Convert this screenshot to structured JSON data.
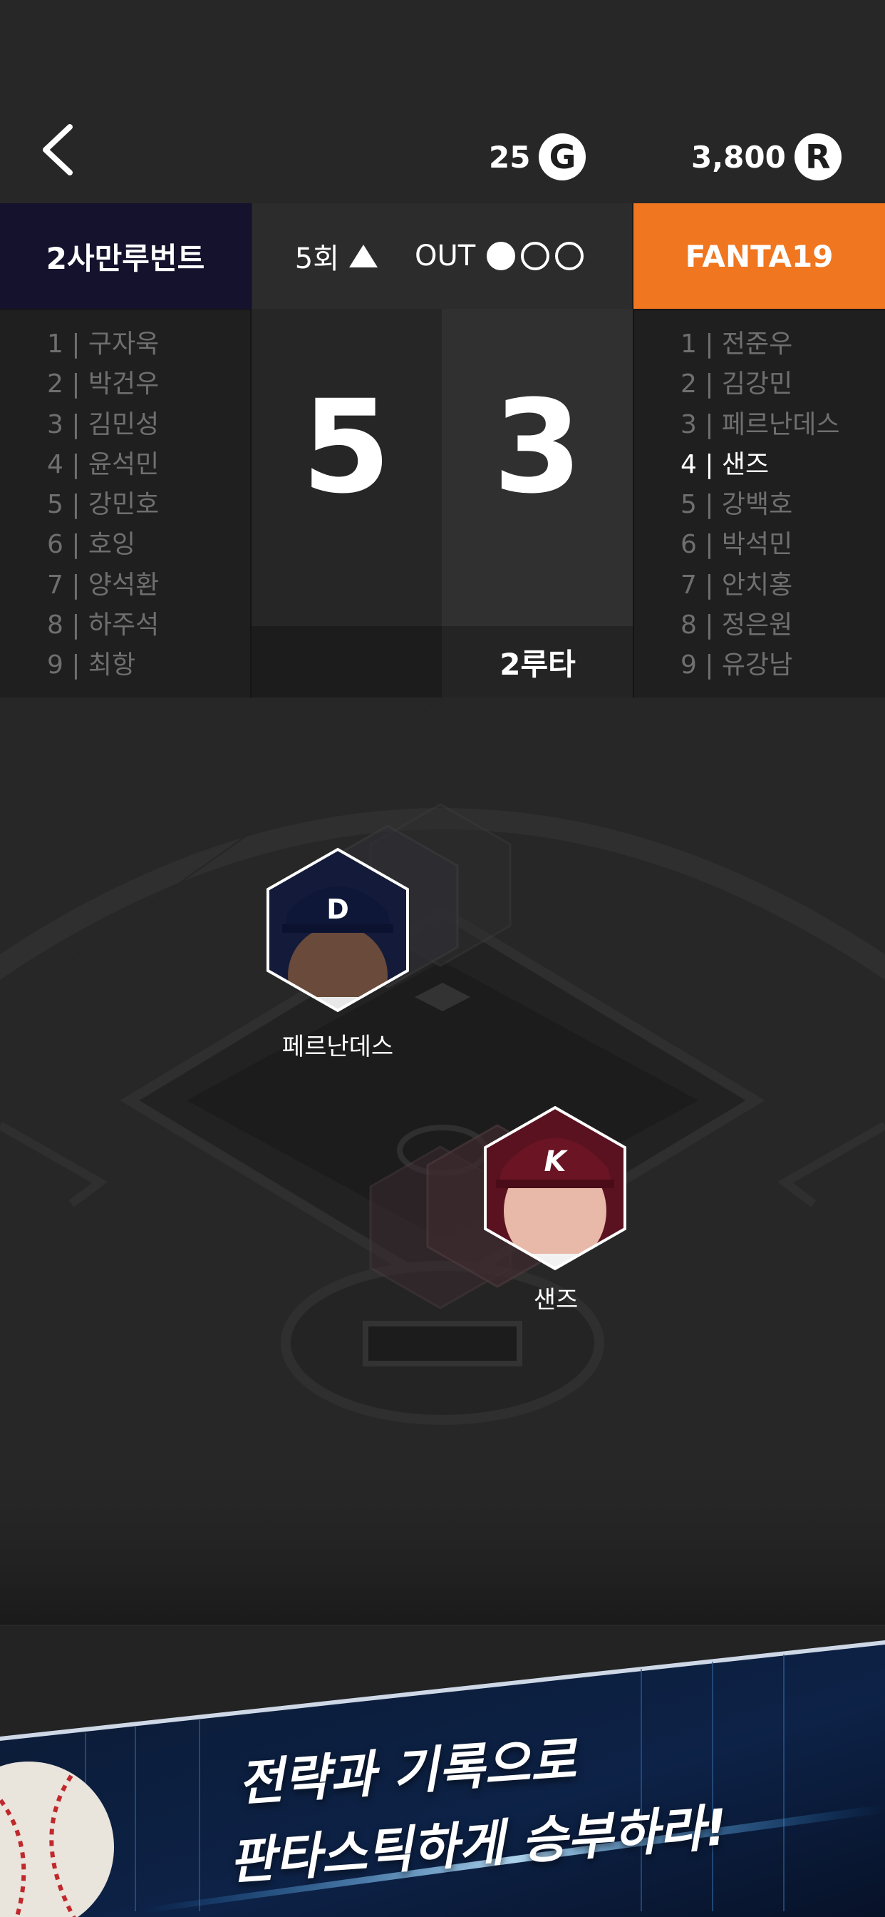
{
  "header": {
    "back_icon": "chevron-left-icon",
    "gold": {
      "value": "25",
      "icon": "G"
    },
    "ruby": {
      "value": "3,800",
      "icon": "R"
    }
  },
  "scoreboard": {
    "team_left": "2사만루번트",
    "team_right": "FANTA19",
    "team_left_color": "#14122d",
    "team_right_color": "#f07620",
    "inning": "5회",
    "out_label": "OUT",
    "outs": 1,
    "score_left": "5",
    "score_right": "3",
    "runner_status": "2루타"
  },
  "lineup_left": [
    "1 | 구자욱",
    "2 | 박건우",
    "3 | 김민성",
    "4 | 윤석민",
    "5 | 강민호",
    "6 | 호잉",
    "7 | 양석환",
    "8 | 하주석",
    "9 | 최항"
  ],
  "lineup_right": [
    "1 | 전준우",
    "2 | 김강민",
    "3 | 페르난데스",
    "4 | 샌즈",
    "5 | 강백호",
    "6 | 박석민",
    "7 | 안치홍",
    "8 | 정은원",
    "9 | 유강남"
  ],
  "field": {
    "player_top": {
      "name": "페르난데스",
      "cap_letter": "D"
    },
    "player_bottom": {
      "name": "샌즈",
      "cap_letter": "K"
    }
  },
  "banner": {
    "line1": "전략과 기록으로",
    "line2": "판타스틱하게 승부하라!"
  }
}
